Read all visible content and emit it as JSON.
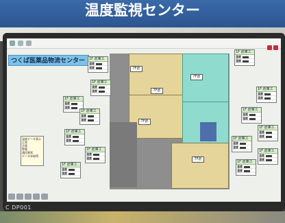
{
  "banner": {
    "title": "温度監視センター"
  },
  "monitor": {
    "brand": "C DP001"
  },
  "app": {
    "title": "つくば医薬品物流センター",
    "zone_tag": "7F倉庫",
    "sensor": {
      "header": "1F 倉庫エリア",
      "rows": [
        "温度",
        "湿度",
        "状態"
      ]
    },
    "legend": {
      "title": "温度データ表示の凡例",
      "items": [
        "正常",
        "注意",
        "警報",
        "通信異常",
        "データ未取得"
      ]
    }
  },
  "colors": {
    "banner": "#2c5590",
    "zone_tan": "#e5d59a",
    "zone_cyan": "#8fdccf",
    "title_bg": "#7fc0e6"
  }
}
